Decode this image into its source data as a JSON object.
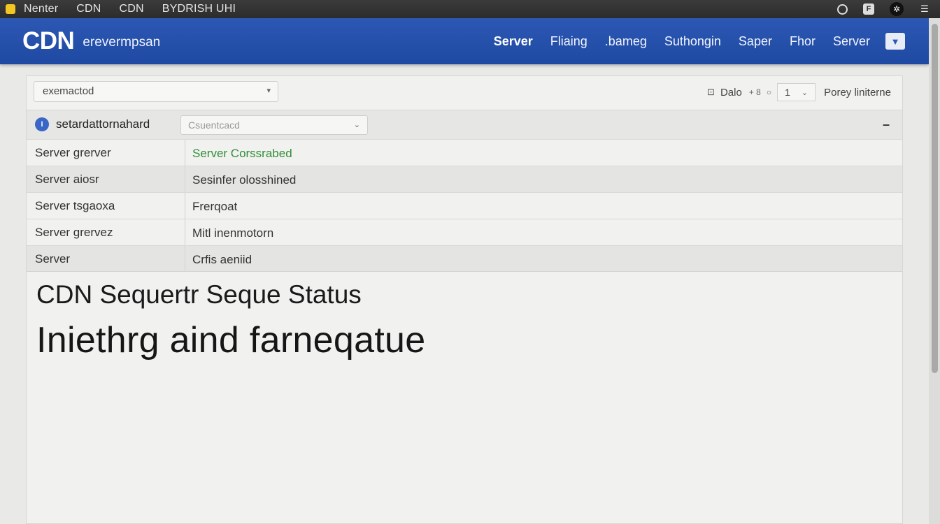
{
  "menubar": {
    "items": [
      "Nenter",
      "CDN",
      "CDN",
      "BYDRISH UHI"
    ]
  },
  "header": {
    "logo": "CDN",
    "tagline": "erevermpsan",
    "nav": [
      "Server",
      "Fliaing",
      ".bameg",
      "Suthongin",
      "Saper",
      "Fhor",
      "Server"
    ],
    "active_nav": "Server",
    "brand_color": "#2553b0"
  },
  "toolbar": {
    "select_value": "exemactod",
    "view_label": "Dalo",
    "plus_count": "+ 8",
    "page_value": "1",
    "per_page_label": "Porey liniterne"
  },
  "subheader": {
    "label": "setardattornahard",
    "select_placeholder": "Csuentcacd"
  },
  "table": {
    "rows": [
      {
        "key": "Server grerver",
        "value": "Server Corssrabed",
        "status": "ok"
      },
      {
        "key": "Server aiosr",
        "value": "Sesinfer olosshined",
        "status": ""
      },
      {
        "key": "Server tsgaoxa",
        "value": "Frerqoat",
        "status": ""
      },
      {
        "key": "Server grervez",
        "value": "Mitl inenmotorn",
        "status": ""
      },
      {
        "key": "Server",
        "value": "Crfis aeniid",
        "status": ""
      }
    ]
  },
  "status": {
    "title": "CDN Sequertr Seque Status",
    "text": "Iniethrg aind farneqatue"
  }
}
